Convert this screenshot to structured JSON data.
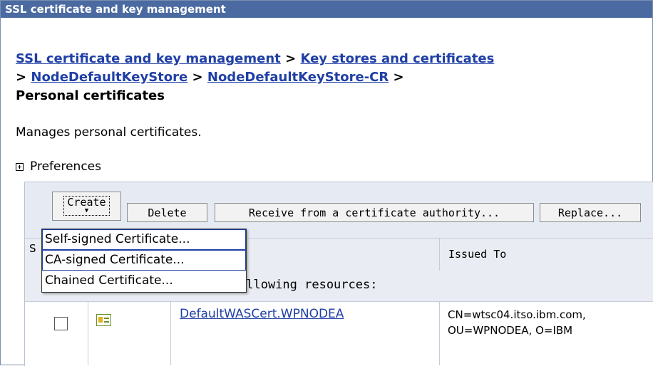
{
  "window": {
    "title": "SSL certificate and key management"
  },
  "breadcrumb": {
    "items": [
      {
        "label": "SSL certificate and key management"
      },
      {
        "label": "Key stores and certificates"
      },
      {
        "label": "NodeDefaultKeyStore"
      },
      {
        "label": "NodeDefaultKeyStore-CR"
      }
    ],
    "separator": ">",
    "current": "Personal certificates"
  },
  "description": "Manages personal certificates.",
  "preferences": {
    "label": "Preferences"
  },
  "toolbar": {
    "create_label": "Create",
    "delete_label": "Delete",
    "receive_label": "Receive from a certificate authority...",
    "replace_label": "Replace..."
  },
  "create_menu": {
    "items": [
      {
        "label": "Self-signed Certificate..."
      },
      {
        "label": "CA-signed Certificate..."
      },
      {
        "label": "Chained Certificate..."
      }
    ]
  },
  "table": {
    "select_header": "S",
    "issued_to_header": "Issued To",
    "filter_text": "ollowing resources:",
    "rows": [
      {
        "alias": "DefaultWASCert.WPNODEA",
        "issued_to_line1": "CN=wtsc04.itso.ibm.com,",
        "issued_to_line2": "OU=WPNODEA, O=IBM"
      }
    ]
  },
  "icons": {
    "preferences": "expand-plus-icon",
    "certificate": "certificate-icon",
    "create_dropdown": "chevron-down-icon"
  },
  "colors": {
    "title_bar": "#4a6aa1",
    "link": "#1f3fa6",
    "toolbar_bg": "#e6ebf3"
  }
}
